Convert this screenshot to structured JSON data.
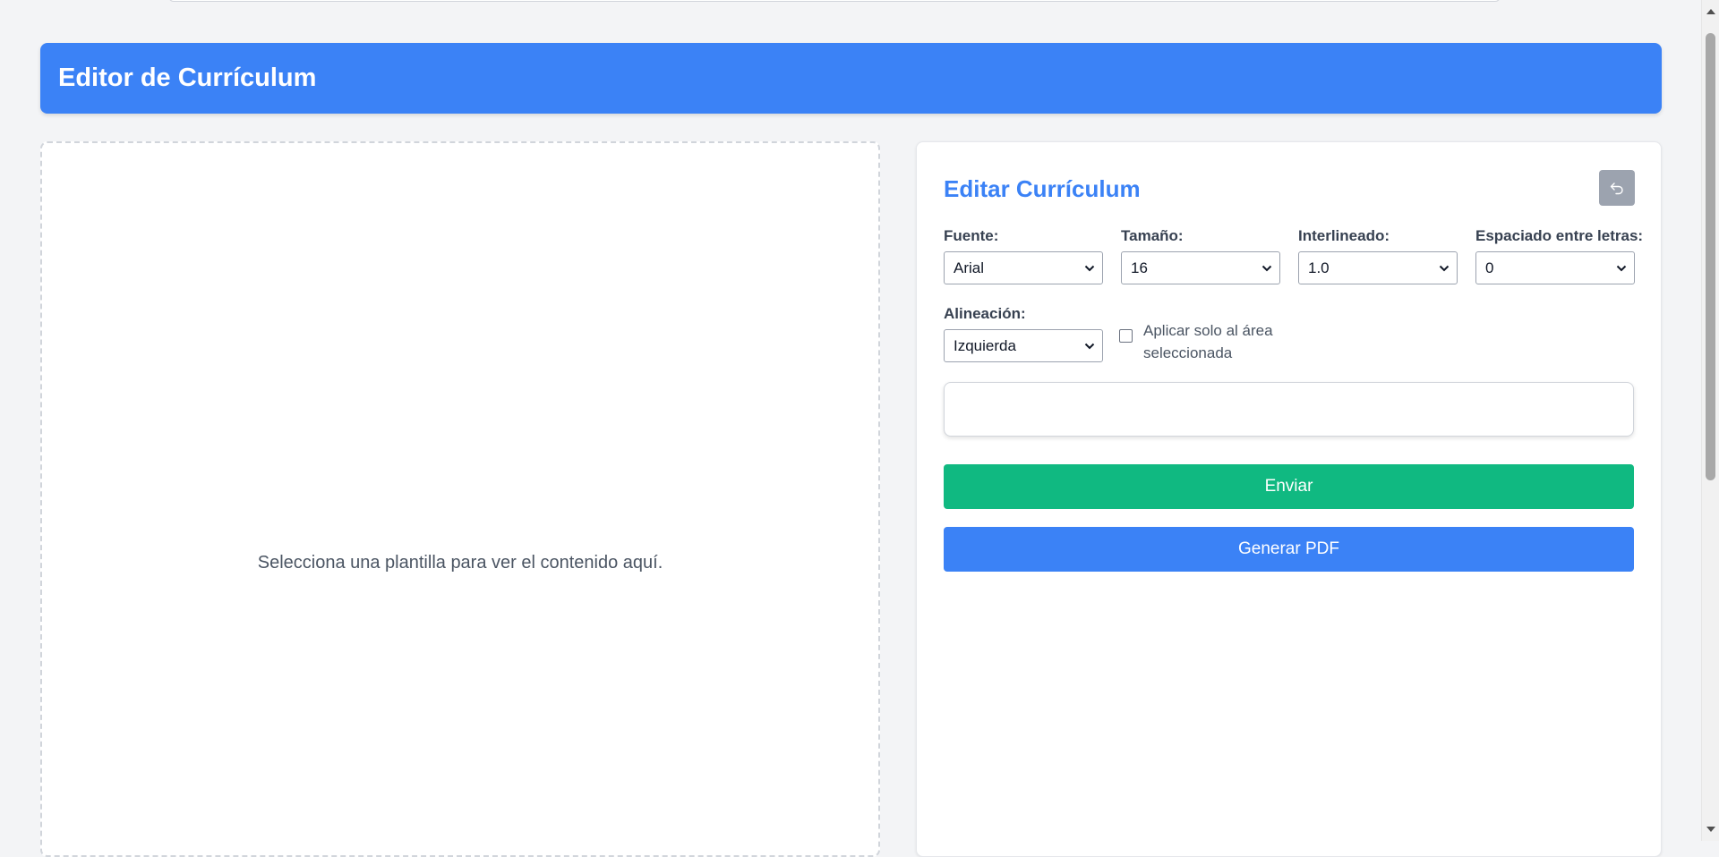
{
  "header": {
    "title": "Editor de Currículum"
  },
  "preview": {
    "placeholder": "Selecciona una plantilla para ver el contenido aquí."
  },
  "editor": {
    "title": "Editar Currículum",
    "undo_icon": "undo-icon",
    "fields": {
      "font": {
        "label": "Fuente:",
        "value": "Arial"
      },
      "size": {
        "label": "Tamaño:",
        "value": "16"
      },
      "line_height": {
        "label": "Interlineado:",
        "value": "1.0"
      },
      "letter_spacing": {
        "label": "Espaciado entre letras:",
        "value": "0"
      },
      "alignment": {
        "label": "Alineación:",
        "value": "Izquierda"
      }
    },
    "apply_selection": {
      "label": "Aplicar solo al área seleccionada",
      "checked": false
    },
    "text_input": {
      "value": "",
      "placeholder": ""
    },
    "send_button": "Enviar",
    "pdf_button": "Generar PDF"
  },
  "colors": {
    "accent": "#3b82f6",
    "success": "#10b981",
    "muted_button": "#9ca3af",
    "background": "#f3f4f6"
  }
}
